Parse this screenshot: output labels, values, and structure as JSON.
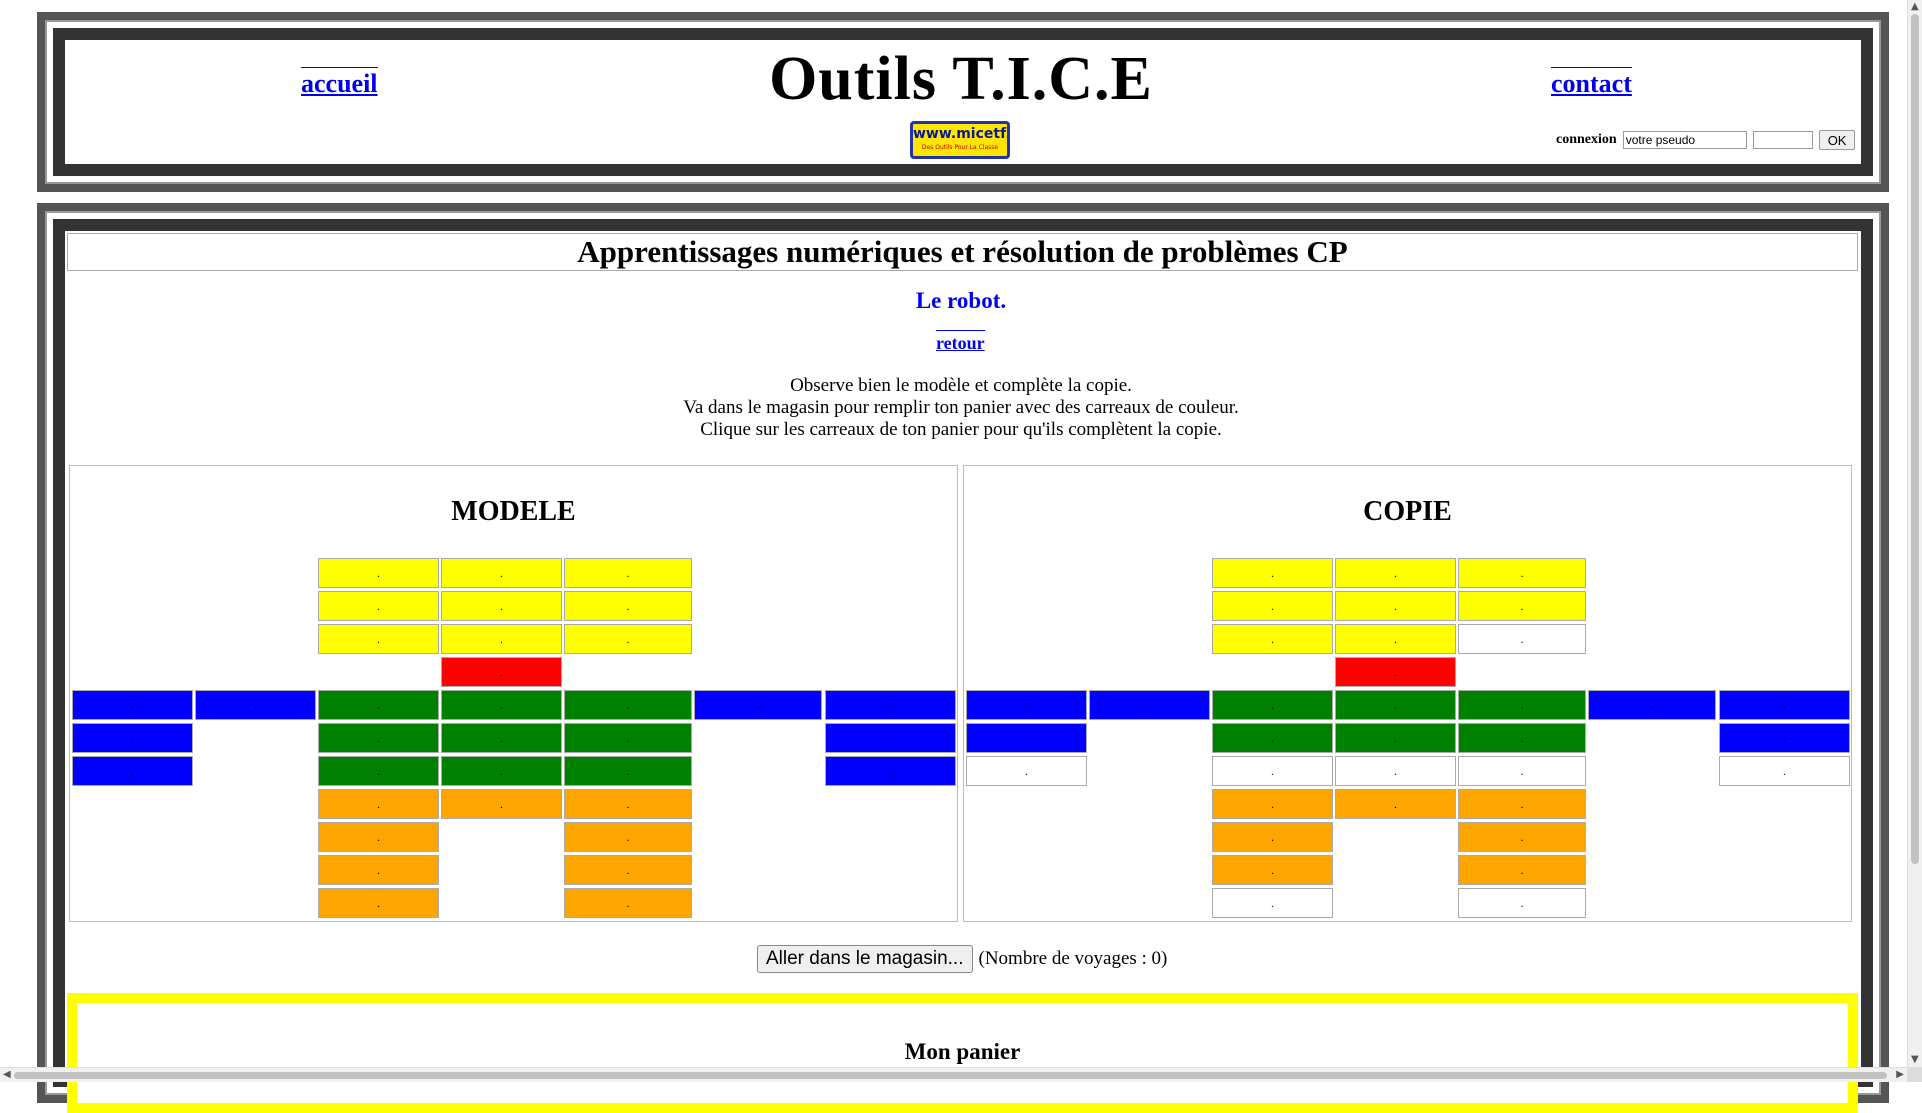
{
  "header": {
    "title": "Outils T.I.C.E",
    "accueil": "accueil",
    "contact": "contact",
    "logo_text": "www.micetf.fr",
    "logo_sub": "Des Outils Pour La Classe",
    "login_label": "connexion",
    "pseudo_value": "votre pseudo",
    "ok_label": "OK"
  },
  "main": {
    "page_title": "Apprentissages numériques et résolution de problèmes CP",
    "subtitle": "Le robot.",
    "retour": "retour",
    "instructions": [
      "Observe bien le modèle et complète la copie.",
      "Va dans le magasin pour remplir ton panier avec des carreaux de couleur.",
      "Clique sur les carreaux de ton panier pour qu'ils complètent la copie."
    ],
    "modele_title": "MODELE",
    "copie_title": "COPIE",
    "shop_button": "Aller dans le magasin...",
    "trips_text": "(Nombre de voyages : 0)",
    "panier_title": "Mon panier"
  },
  "colors": {
    "yellow": "#ffff00",
    "red": "#ff0000",
    "blue": "#0000ff",
    "green": "#008000",
    "orange": "#ffa500",
    "white": "#ffffff"
  },
  "grid": {
    "cell_mark": ".",
    "modele": [
      [
        "",
        "",
        "yellow",
        "yellow",
        "yellow",
        "",
        ""
      ],
      [
        "",
        "",
        "yellow",
        "yellow",
        "yellow",
        "",
        ""
      ],
      [
        "",
        "",
        "yellow",
        "yellow",
        "yellow",
        "",
        ""
      ],
      [
        "",
        "",
        "",
        "red",
        "",
        "",
        ""
      ],
      [
        "blue",
        "blue",
        "green",
        "green",
        "green",
        "blue",
        "blue"
      ],
      [
        "blue",
        "",
        "green",
        "green",
        "green",
        "",
        "blue"
      ],
      [
        "blue",
        "",
        "green",
        "green",
        "green",
        "",
        "blue"
      ],
      [
        "",
        "",
        "orange",
        "orange",
        "orange",
        "",
        ""
      ],
      [
        "",
        "",
        "orange",
        "",
        "orange",
        "",
        ""
      ],
      [
        "",
        "",
        "orange",
        "",
        "orange",
        "",
        ""
      ],
      [
        "",
        "",
        "orange",
        "",
        "orange",
        "",
        ""
      ]
    ],
    "copie": [
      [
        "",
        "",
        "yellow",
        "yellow",
        "yellow",
        "",
        ""
      ],
      [
        "",
        "",
        "yellow",
        "yellow",
        "yellow",
        "",
        ""
      ],
      [
        "",
        "",
        "yellow",
        "yellow",
        "white",
        "",
        ""
      ],
      [
        "",
        "",
        "",
        "red",
        "",
        "",
        ""
      ],
      [
        "blue",
        "blue",
        "green",
        "green",
        "green",
        "blue",
        "blue"
      ],
      [
        "blue",
        "",
        "green",
        "green",
        "green",
        "",
        "blue"
      ],
      [
        "white",
        "",
        "white",
        "white",
        "white",
        "",
        "white"
      ],
      [
        "",
        "",
        "orange",
        "orange",
        "orange",
        "",
        ""
      ],
      [
        "",
        "",
        "orange",
        "",
        "orange",
        "",
        ""
      ],
      [
        "",
        "",
        "orange",
        "",
        "orange",
        "",
        ""
      ],
      [
        "",
        "",
        "white",
        "",
        "white",
        "",
        ""
      ]
    ]
  }
}
